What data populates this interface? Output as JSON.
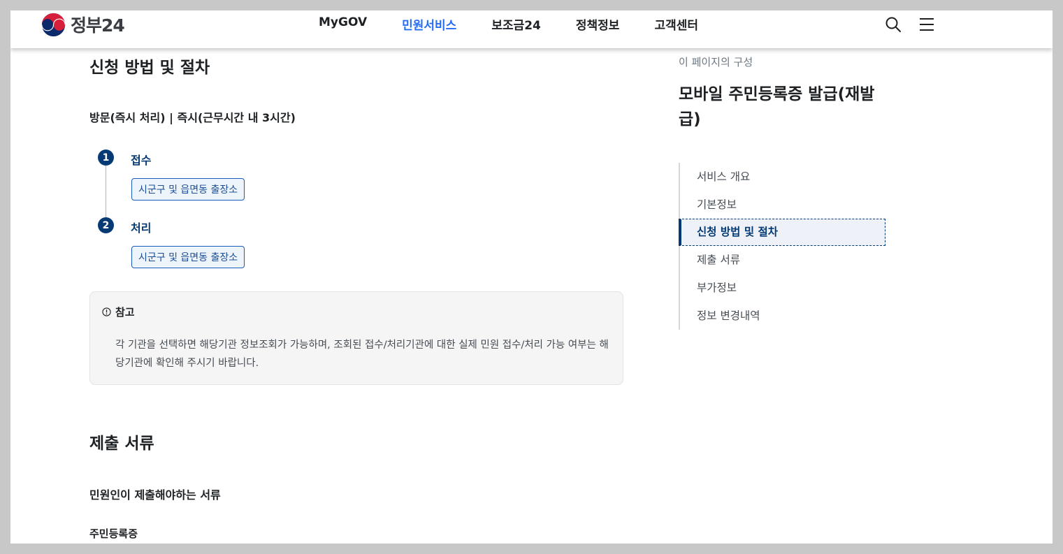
{
  "header": {
    "logo_text": "정부24",
    "nav": [
      "MyGOV",
      "민원서비스",
      "보조금24",
      "정책정보",
      "고객센터"
    ],
    "active_nav": "민원서비스",
    "icons": [
      "search-icon",
      "hamburger-menu-icon"
    ]
  },
  "procedure": {
    "title": "신청 방법 및 절차",
    "method": "방문(즉시 처리) | 즉시(근무시간 내 3시간)",
    "steps": [
      {
        "num": "1",
        "label": "접수",
        "org": "시군구 및 읍면동 출장소"
      },
      {
        "num": "2",
        "label": "처리",
        "org": "시군구 및 읍면동 출장소"
      }
    ]
  },
  "note": {
    "icon": "info-circle-icon",
    "title": "참고",
    "body": "각 기관을 선택하면 해당기관 정보조회가 가능하며, 조회된 접수/처리기관에 대한 실제 민원 접수/처리 가능 여부는 해당기관에 확인해 주시기 바랍니다."
  },
  "documents": {
    "title": "제출 서류",
    "subtitle": "민원인이 제출해야하는 서류",
    "first_item": "주민등록증"
  },
  "aside": {
    "caption": "이 페이지의 구성",
    "title": "모바일 주민등록증 발급(재발급)",
    "toc": [
      "서비스 개요",
      "기본정보",
      "신청 방법 및 절차",
      "제출 서류",
      "부가정보",
      "정보 변경내역"
    ],
    "active_toc": "신청 방법 및 절차"
  },
  "colors": {
    "primary_navy": "#063a74",
    "nav_active_blue": "#256ef4",
    "background_frame": "#c8c8c8"
  }
}
